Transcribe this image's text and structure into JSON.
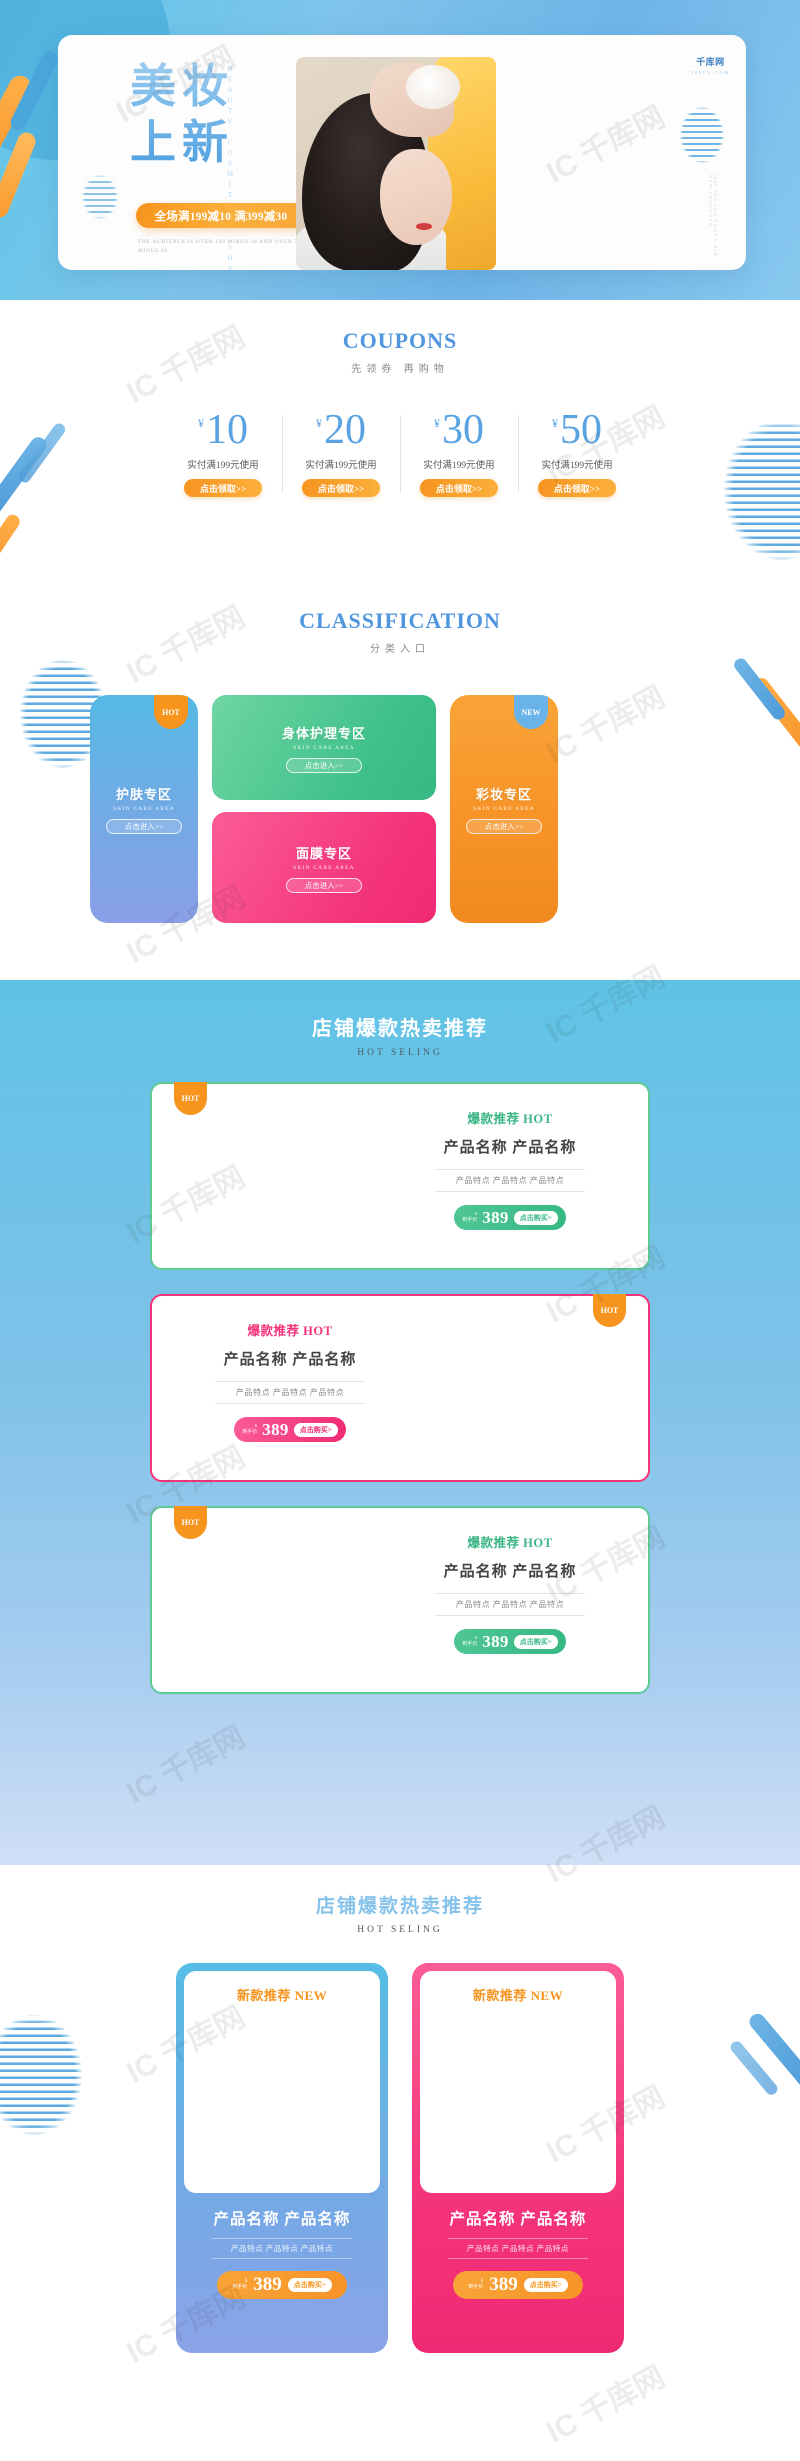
{
  "hero": {
    "title_line1": "美妆",
    "title_line2": "上新",
    "vertical_en": "BEAUTY COSMETICS SHANGXIN",
    "promo_pill": "全场满199减10 满399减30",
    "promo_en": "THE AUDIENCE IS OVER 199 MINUS 10 AND OVER 399 MINUS 30",
    "logo_text": "千库网",
    "logo_sub": "588PX.COM",
    "right_vertical": "MEI ZHUANG SHANG XIN  NEW PRODUCTS"
  },
  "coupons": {
    "title_en": "COUPONS",
    "title_cn": "先领券 再购物",
    "currency": "¥",
    "items": [
      {
        "amount": "10",
        "desc": "实付满199元使用",
        "button": "点击领取>>"
      },
      {
        "amount": "20",
        "desc": "实付满199元使用",
        "button": "点击领取>>"
      },
      {
        "amount": "30",
        "desc": "实付满199元使用",
        "button": "点击领取>>"
      },
      {
        "amount": "50",
        "desc": "实付满199元使用",
        "button": "点击领取>>"
      }
    ]
  },
  "classification": {
    "title_en": "CLASSIFICATION",
    "title_cn": "分类入口",
    "cards": [
      {
        "cn": "护肤专区",
        "en": "SKIN CARE AREA",
        "enter": "点击进入>>",
        "badge": "HOT"
      },
      {
        "cn": "身体护理专区",
        "en": "SKIN CARE AREA",
        "enter": "点击进入>>"
      },
      {
        "cn": "面膜专区",
        "en": "SKIN CARE AREA",
        "enter": "点击进入>>"
      },
      {
        "cn": "彩妆专区",
        "en": "SKIN CARE AREA",
        "enter": "点击进入>>",
        "badge": "NEW"
      }
    ]
  },
  "hot_selling": {
    "title_cn": "店铺爆款热卖推荐",
    "title_en": "HOT SELING",
    "products": [
      {
        "badge": "HOT",
        "tag": "爆款推荐 HOT",
        "name": "产品名称 产品名称",
        "features": "产品特点 产品特点 产品特点",
        "price_label": "到手价",
        "currency": "¥",
        "price": "389",
        "buy": "点击购买>"
      },
      {
        "badge": "HOT",
        "tag": "爆款推荐 HOT",
        "name": "产品名称 产品名称",
        "features": "产品特点 产品特点 产品特点",
        "price_label": "到手价",
        "currency": "¥",
        "price": "389",
        "buy": "点击购买>"
      },
      {
        "badge": "HOT",
        "tag": "爆款推荐 HOT",
        "name": "产品名称 产品名称",
        "features": "产品特点 产品特点 产品特点",
        "price_label": "到手价",
        "currency": "¥",
        "price": "389",
        "buy": "点击购买>"
      }
    ]
  },
  "new_section": {
    "title_cn": "店铺爆款热卖推荐",
    "title_en": "HOT SELING",
    "cards": [
      {
        "tag": "新款推荐 NEW",
        "name": "产品名称 产品名称",
        "features": "产品特点 产品特点 产品特点",
        "price_label": "到手价",
        "currency": "¥",
        "price": "389",
        "buy": "点击购买>"
      },
      {
        "tag": "新款推荐 NEW",
        "name": "产品名称 产品名称",
        "features": "产品特点 产品特点 产品特点",
        "price_label": "到手价",
        "currency": "¥",
        "price": "389",
        "buy": "点击购买>"
      }
    ]
  },
  "watermark": {
    "text": "IC 千库网"
  },
  "colors": {
    "brand_blue": "#5aa3e2",
    "accent_orange": "#f7941d",
    "green": "#3bb584",
    "pink": "#f4347a",
    "hero_bg": "#6fb5e8"
  }
}
